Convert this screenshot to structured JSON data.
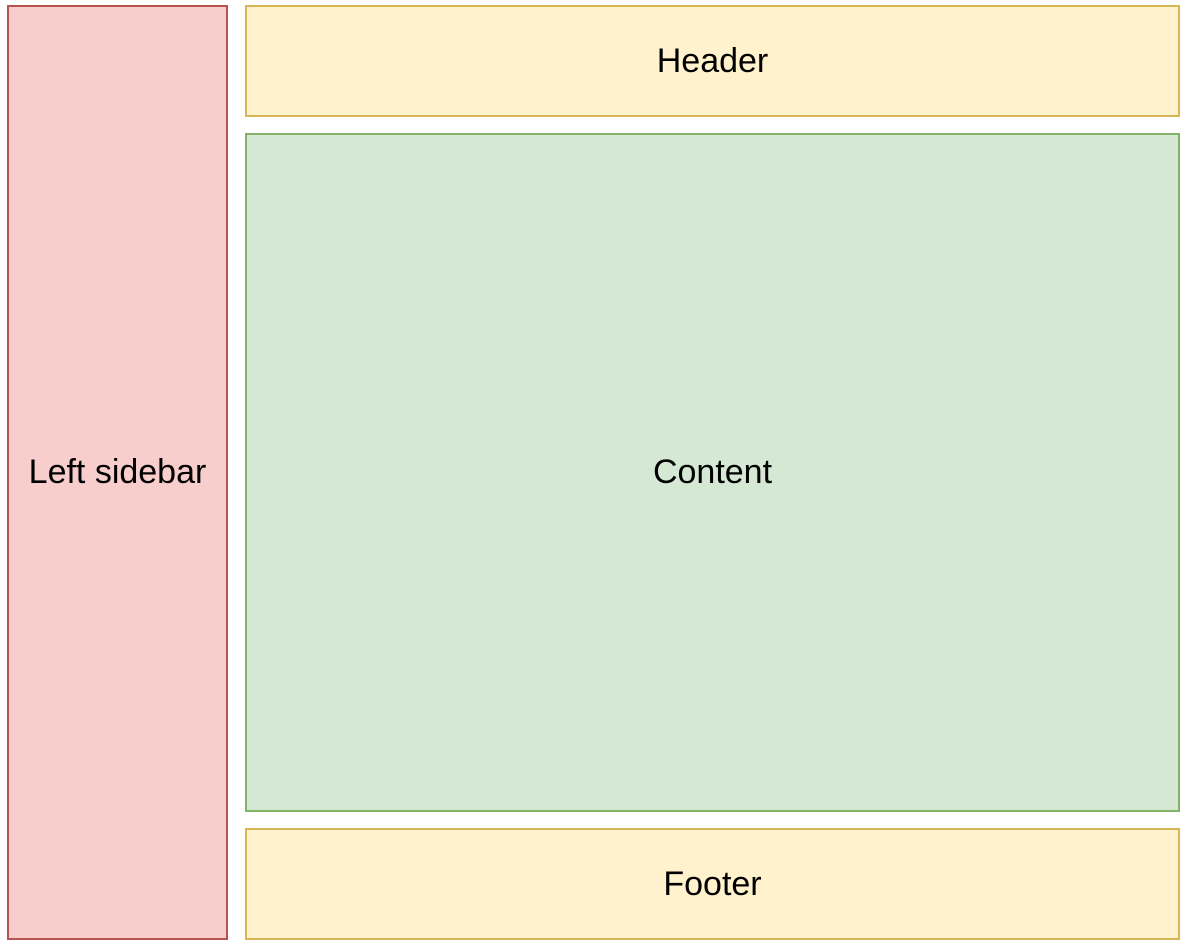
{
  "sidebar": {
    "label": "Left sidebar",
    "fill": "#f8cecc",
    "stroke": "#b85450"
  },
  "header": {
    "label": "Header",
    "fill": "#fff2cc",
    "stroke": "#d6b656"
  },
  "content": {
    "label": "Content",
    "fill": "#d5e8d4",
    "stroke": "#82b366"
  },
  "footer": {
    "label": "Footer",
    "fill": "#fff2cc",
    "stroke": "#d6b656"
  }
}
